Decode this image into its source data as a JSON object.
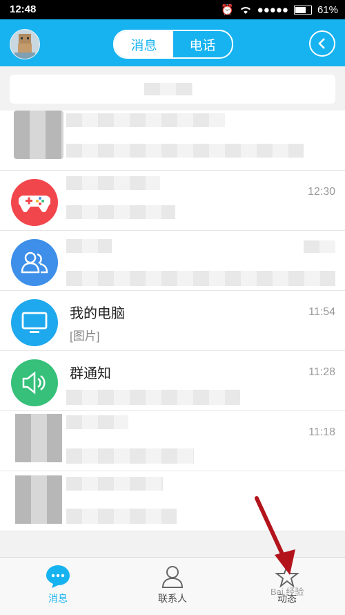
{
  "status": {
    "time": "12:48",
    "signal": "●●●●●",
    "battery": "61%",
    "battery_level": 0.61
  },
  "header": {
    "tabs": [
      {
        "label": "消息"
      },
      {
        "label": "电话"
      }
    ]
  },
  "rows": [
    {
      "name": "",
      "message": "",
      "time": "",
      "icon": "blurred-avatar"
    },
    {
      "name": "",
      "message": "",
      "time": "12:30",
      "icon": "gamepad-icon",
      "color": "#f2464d"
    },
    {
      "name": "",
      "message": "",
      "time": "",
      "icon": "group-icon",
      "color": "#3d8fe9"
    },
    {
      "name": "我的电脑",
      "message": "[图片]",
      "time": "11:54",
      "icon": "monitor-icon",
      "color": "#1ea8ee"
    },
    {
      "name": "群通知",
      "message": "",
      "time": "11:28",
      "icon": "speaker-icon",
      "color": "#36c07a"
    },
    {
      "name": "",
      "message": "",
      "time": "11:18",
      "icon": "blurred-avatar"
    },
    {
      "name": "",
      "message": "",
      "time": "",
      "icon": "blurred-avatar"
    }
  ],
  "tabbar": {
    "items": [
      {
        "label": "消息"
      },
      {
        "label": "联系人"
      },
      {
        "label": "动态"
      }
    ]
  },
  "watermark": "Bai 经验",
  "colors": {
    "accent": "#17b3f0",
    "annotation_arrow": "#b3141c"
  }
}
